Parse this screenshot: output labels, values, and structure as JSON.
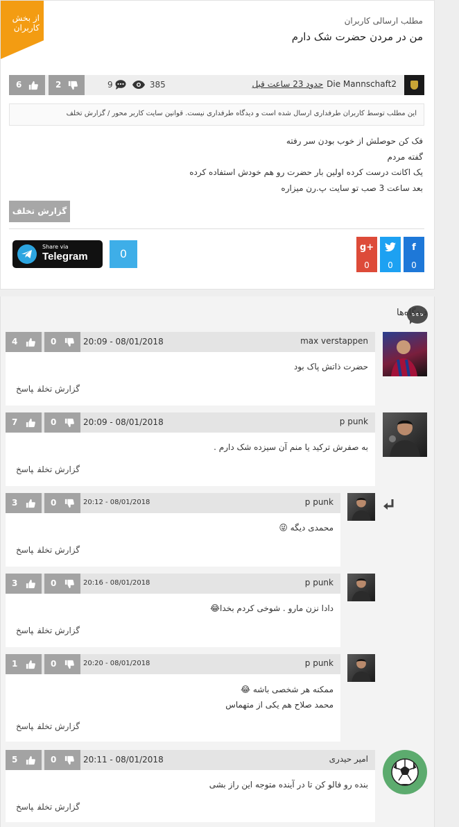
{
  "post": {
    "badge": "از بخش کاربران",
    "category": "مطلب ارسالی کاربران",
    "title": "من در مردن حضرت شک دارم",
    "author": "Die Mannschaft2",
    "time_ago": "حدود 23 ساعت قبل",
    "views": "385",
    "comments_count": "9",
    "dislikes": "2",
    "likes": "6",
    "notice": "این مطلب توسط کاربران طرفداری ارسال شده است و دیدگاه طرفداری نیست. قوانین سایت کاربر محور / گزارش تخلف",
    "body_lines": [
      "فک کن حوصلش از خوب بودن سر رفته",
      "گفته مردم",
      "یک اکانت درست کرده اولین بار حضرت رو هم خودش استفاده کرده",
      "بعد ساعت 3 صب تو سایت پ.رن میزاره"
    ],
    "report_label": "گزارش تخلف"
  },
  "share": {
    "telegram_small": "Share via",
    "telegram_big": "Telegram",
    "share_count": "0",
    "facebook_count": "0",
    "twitter_count": "0",
    "googleplus_count": "0",
    "facebook_label": "f",
    "googleplus_label": "g+"
  },
  "colors": {
    "badge": "#f39c12",
    "telegram": "#2ca5e0",
    "facebook": "#1e78d8",
    "twitter": "#1da1f2",
    "googleplus": "#dd4b39",
    "vote_button": "#a3a3a3"
  },
  "comments_section": {
    "heading": "دیدگاه‌ها"
  },
  "comment_actions": {
    "report": "گزارش تخلف",
    "reply": "پاسخ"
  },
  "comments": [
    {
      "name": "max verstappen",
      "date": "20:09 - 08/01/2018",
      "likes": "4",
      "dislikes": "0",
      "text": [
        "حضرت ذاتش پاک بود"
      ],
      "avatar": "player-photo"
    },
    {
      "name": "p punk",
      "date": "20:09 - 08/01/2018",
      "likes": "7",
      "dislikes": "0",
      "text": [
        "به صفرش ترکید یا منم آن سیزده شک دارم ."
      ],
      "avatar": "singer-photo"
    },
    {
      "name": "p punk",
      "date": "20:12 - 08/01/2018",
      "likes": "3",
      "dislikes": "0",
      "text": [
        "محمدی دیگه 😜"
      ],
      "avatar": "singer-photo"
    },
    {
      "name": "p punk",
      "date": "20:16 - 08/01/2018",
      "likes": "3",
      "dislikes": "0",
      "text": [
        "دادا نزن مارو . شوخی کردم بخدا😂"
      ],
      "avatar": "singer-photo"
    },
    {
      "name": "p punk",
      "date": "20:20 - 08/01/2018",
      "likes": "1",
      "dislikes": "0",
      "text": [
        "ممکنه هر شخصی باشه 😂",
        "محمد صلاح هم یکی از متهماس"
      ],
      "avatar": "singer-photo"
    },
    {
      "name": "امیر حیدری",
      "date": "20:11 - 08/01/2018",
      "likes": "5",
      "dislikes": "0",
      "text": [
        "بنده رو فالو کن تا در آینده متوجه این راز بشی"
      ],
      "avatar": "soccer-ball"
    }
  ]
}
